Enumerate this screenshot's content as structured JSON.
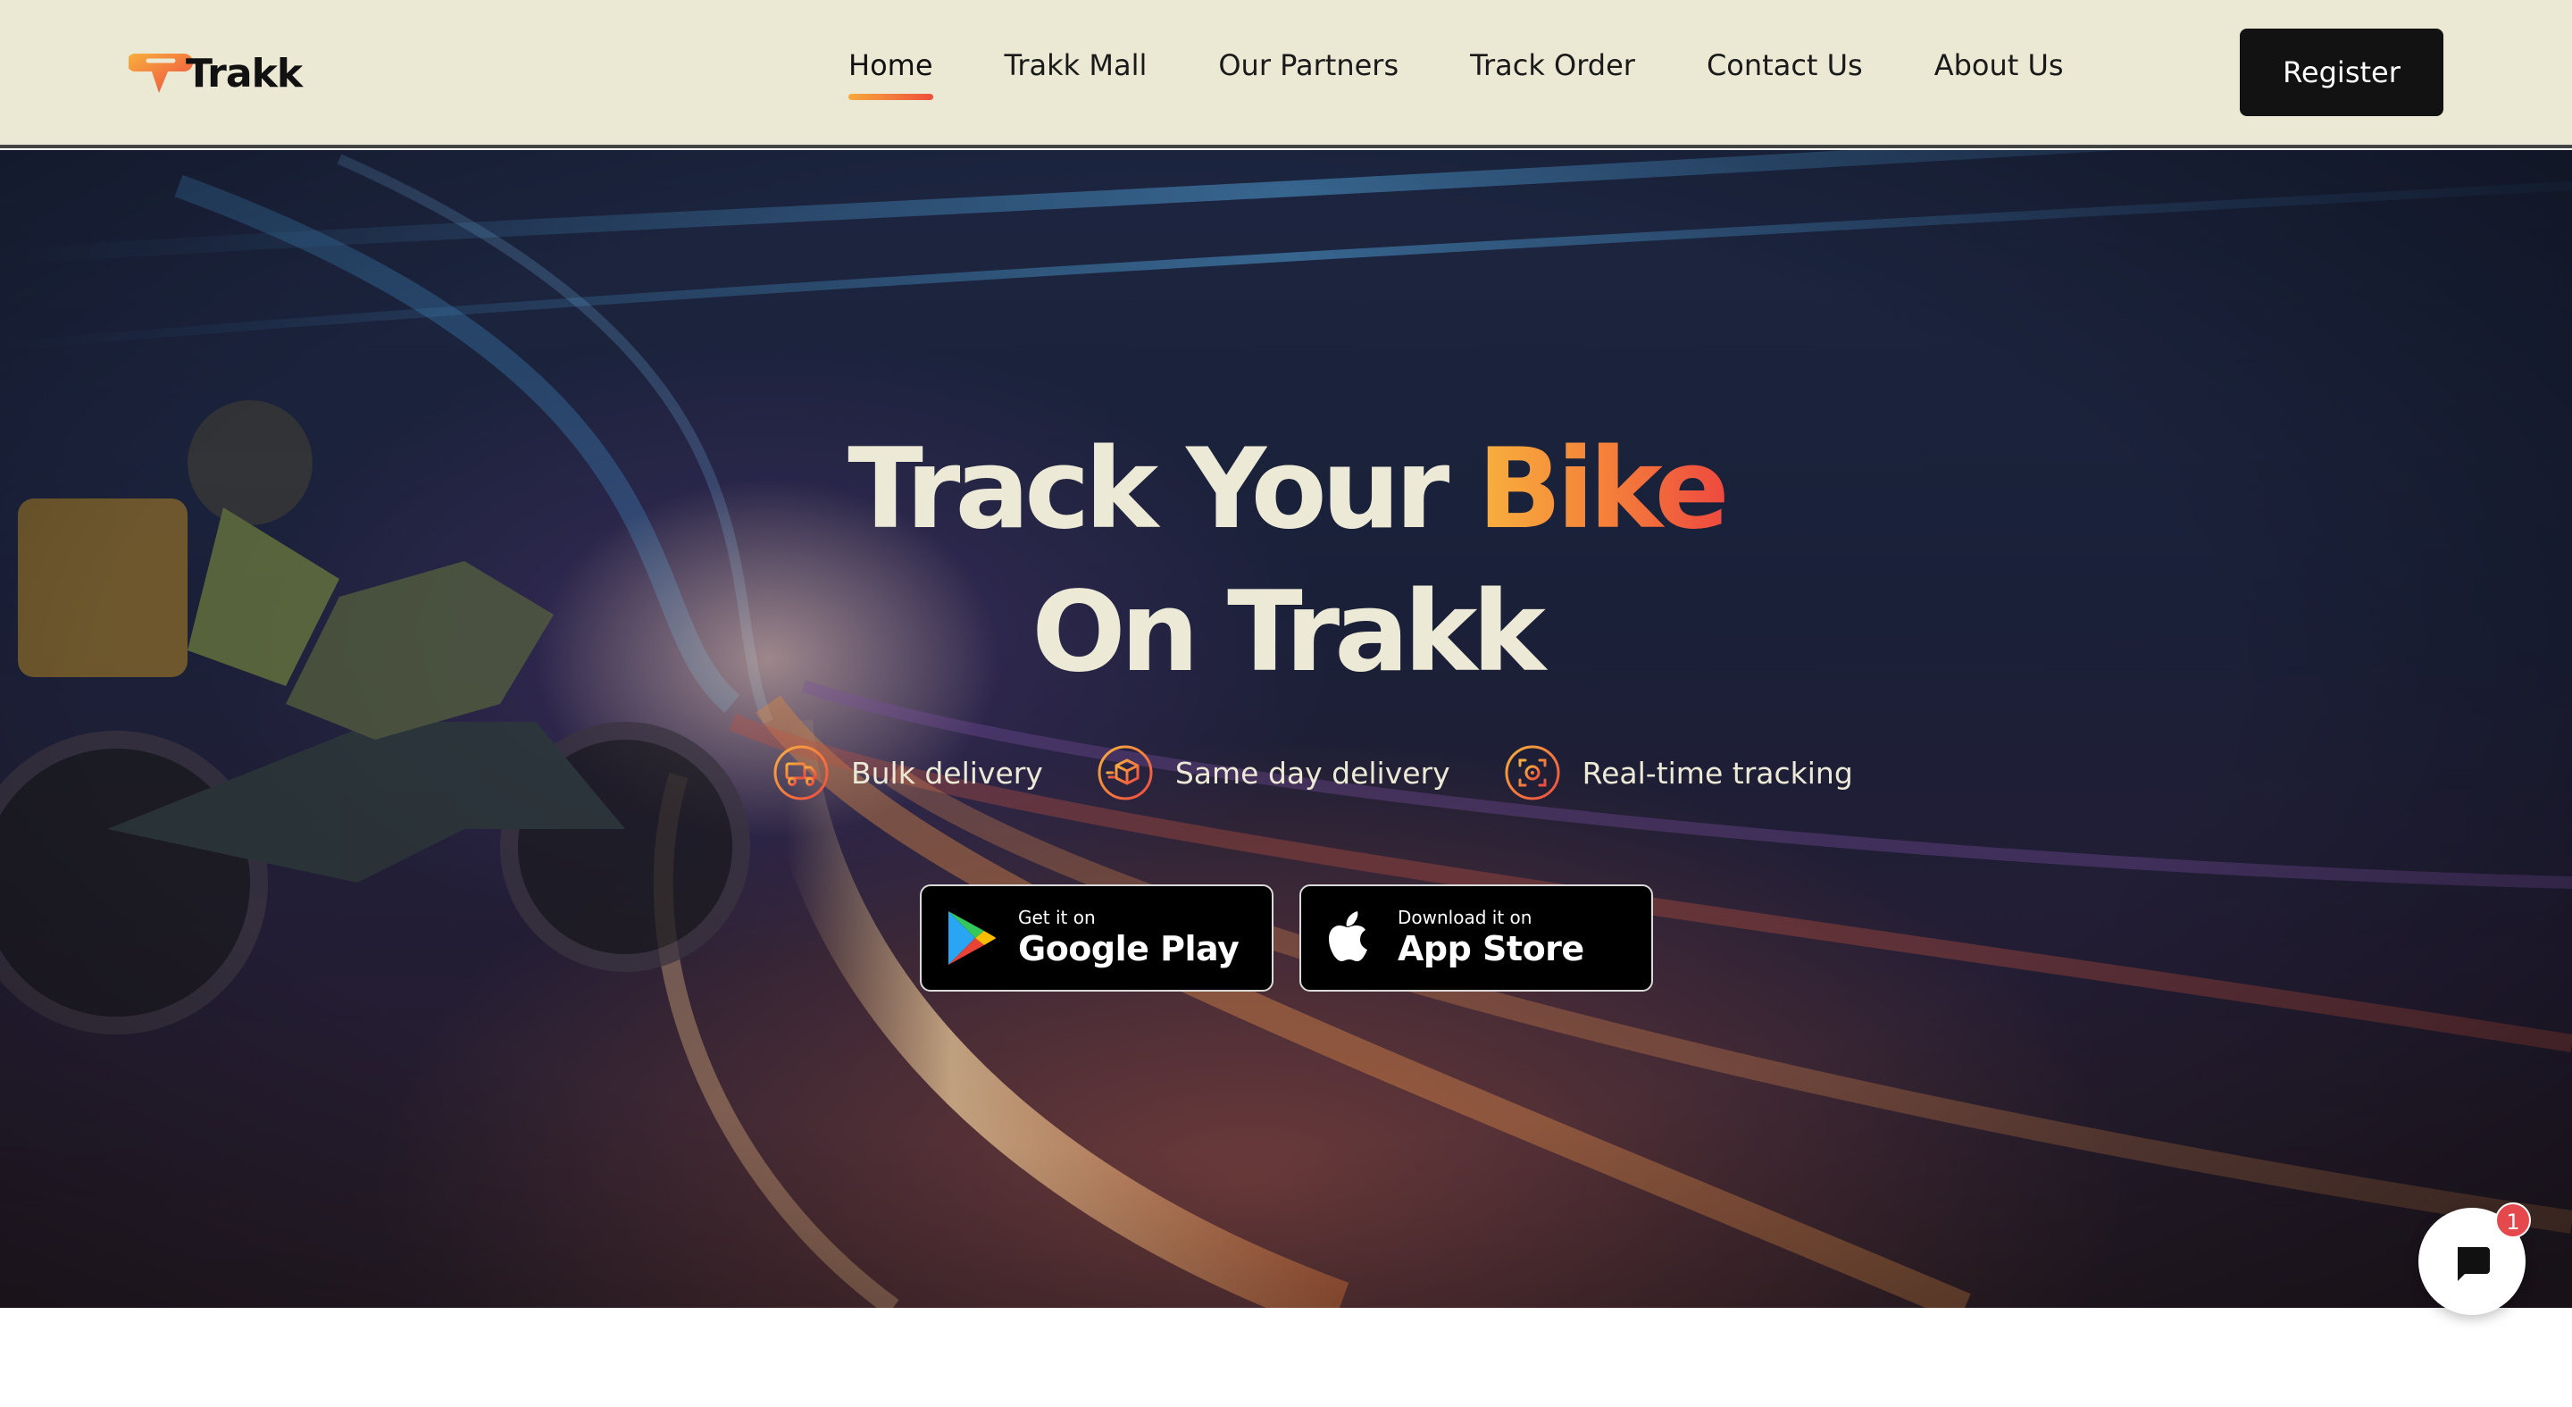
{
  "brand": {
    "name": "Trakk"
  },
  "nav": {
    "items": [
      {
        "label": "Home",
        "active": true
      },
      {
        "label": "Trakk Mall"
      },
      {
        "label": "Our Partners"
      },
      {
        "label": "Track Order"
      },
      {
        "label": "Contact Us"
      },
      {
        "label": "About Us"
      }
    ],
    "register_label": "Register"
  },
  "hero": {
    "title_line1_prefix": "Track Your ",
    "title_line1_accent": "Bike",
    "title_line2": "On Trakk",
    "features": [
      {
        "icon": "truck-icon",
        "label": "Bulk delivery"
      },
      {
        "icon": "box-icon",
        "label": "Same day delivery"
      },
      {
        "icon": "tracking-icon",
        "label": "Real-time tracking"
      }
    ]
  },
  "store_buttons": {
    "google_play": {
      "small": "Get it on",
      "big": "Google Play",
      "icon": "google-play-icon"
    },
    "app_store": {
      "small": "Download it on",
      "big": "App Store",
      "icon": "apple-icon"
    }
  },
  "chat": {
    "icon": "chat-bubble-icon",
    "badge_count": "1"
  },
  "colors": {
    "header_bg": "#ebe8d4",
    "accent_start": "#f8b13e",
    "accent_end": "#ee4a3f",
    "hero_text": "#ece9d6",
    "button_dark": "#121212",
    "badge_red": "#e5484d"
  }
}
